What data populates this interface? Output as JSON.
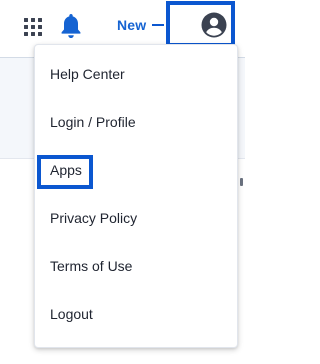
{
  "header": {
    "new_label": "New"
  },
  "icons": {
    "apps_grid": "apps-grid-icon",
    "notifications": "bell-icon",
    "profile": "account-circle-icon"
  },
  "menu": {
    "items": [
      {
        "label": "Help Center"
      },
      {
        "label": "Login / Profile"
      },
      {
        "label": "Apps"
      },
      {
        "label": "Privacy Policy"
      },
      {
        "label": "Terms of Use"
      },
      {
        "label": "Logout"
      }
    ]
  },
  "colors": {
    "accent": "#1563d2",
    "highlight": "#0b57d0",
    "icon": "#3b4251",
    "text": "#1f2430"
  }
}
